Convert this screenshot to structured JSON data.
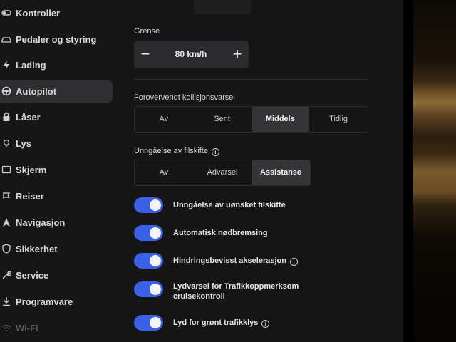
{
  "sidebar": {
    "items": [
      {
        "label": "Kontroller",
        "icon": "toggle-icon"
      },
      {
        "label": "Pedaler og styring",
        "icon": "car-icon"
      },
      {
        "label": "Lading",
        "icon": "lightning-icon"
      },
      {
        "label": "Autopilot",
        "icon": "steering-wheel-icon",
        "active": true
      },
      {
        "label": "Låser",
        "icon": "lock-icon"
      },
      {
        "label": "Lys",
        "icon": "light-bulb-icon"
      },
      {
        "label": "Skjerm",
        "icon": "display-icon"
      },
      {
        "label": "Reiser",
        "icon": "trip-icon"
      },
      {
        "label": "Navigasjon",
        "icon": "navigation-icon"
      },
      {
        "label": "Sikkerhet",
        "icon": "shield-icon"
      },
      {
        "label": "Service",
        "icon": "wrench-icon"
      },
      {
        "label": "Programvare",
        "icon": "download-icon"
      },
      {
        "label": "Wi-Fi",
        "icon": "wifi-icon"
      }
    ]
  },
  "limit": {
    "label": "Grense",
    "value": "80 km/h",
    "minus": "−",
    "plus": "+"
  },
  "collision": {
    "label": "Forovervendt kollisjonsvarsel",
    "options": [
      "Av",
      "Sent",
      "Middels",
      "Tidlig"
    ],
    "selected": "Middels"
  },
  "lane": {
    "label": "Unngåelse av filskifte",
    "info": "i",
    "options": [
      "Av",
      "Advarsel",
      "Assistanse"
    ],
    "selected": "Assistanse"
  },
  "toggles": [
    {
      "label": "Unngåelse av uønsket filskifte",
      "on": true,
      "info": false
    },
    {
      "label": "Automatisk nødbremsing",
      "on": true,
      "info": false
    },
    {
      "label": "Hindringsbevisst akselerasjon",
      "on": true,
      "info": true
    },
    {
      "label": "Lydvarsel for Trafikkoppmerksom cruisekontroll",
      "on": true,
      "info": false
    },
    {
      "label": "Lyd for grønt trafikklys",
      "on": true,
      "info": true
    }
  ],
  "colors": {
    "accent": "#3a61e6",
    "background": "#151516",
    "selected_segment": "#353537"
  }
}
